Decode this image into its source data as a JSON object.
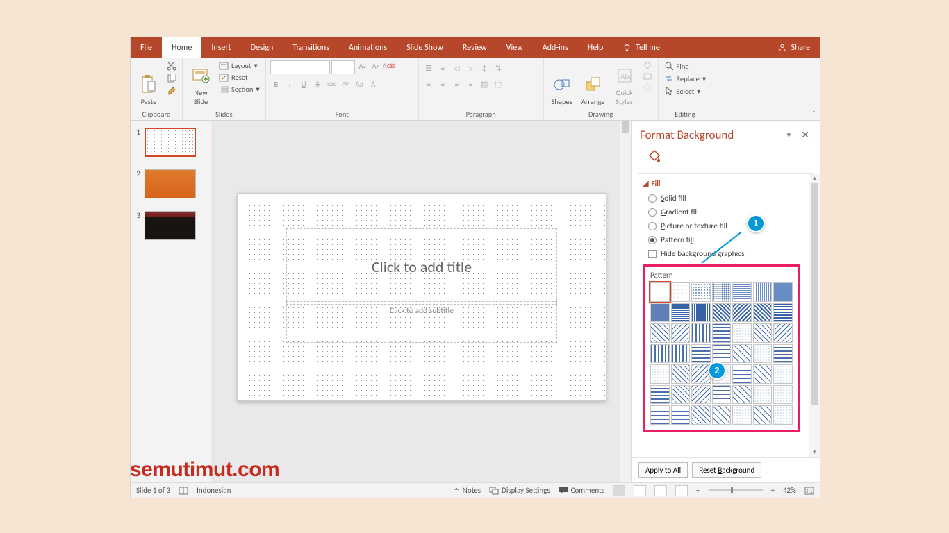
{
  "menu": {
    "tabs": [
      "File",
      "Home",
      "Insert",
      "Design",
      "Transitions",
      "Animations",
      "Slide Show",
      "Review",
      "View",
      "Add-ins",
      "Help"
    ],
    "active": 1,
    "tellme": "Tell me",
    "share": "Share"
  },
  "ribbon": {
    "clipboard": {
      "label": "Clipboard",
      "paste": "Paste"
    },
    "slides": {
      "label": "Slides",
      "newslide": "New\nSlide",
      "layout": "Layout",
      "reset": "Reset",
      "section": "Section"
    },
    "font": {
      "label": "Font"
    },
    "paragraph": {
      "label": "Paragraph"
    },
    "drawing": {
      "label": "Drawing",
      "shapes": "Shapes",
      "arrange": "Arrange",
      "quick": "Quick\nStyles"
    },
    "editing": {
      "label": "Editing",
      "find": "Find",
      "replace": "Replace",
      "select": "Select"
    }
  },
  "thumbs": [
    "1",
    "2",
    "3"
  ],
  "slide": {
    "title": "Click to add title",
    "subtitle": "Click to add subtitle"
  },
  "panel": {
    "title": "Format Background",
    "section": "Fill",
    "solid": "Solid fill",
    "gradient": "Gradient fill",
    "picture": "Picture or texture fill",
    "pattern": "Pattern fill",
    "hide": "Hide background graphics",
    "pattern_lbl": "Pattern",
    "apply": "Apply to All",
    "reset": "Reset Background"
  },
  "status": {
    "slide": "Slide 1 of 3",
    "lang": "Indonesian",
    "notes": "Notes",
    "display": "Display Settings",
    "comments": "Comments",
    "zoom": "42%"
  },
  "callouts": {
    "one": "1",
    "two": "2"
  },
  "watermark": "semutimut.com"
}
